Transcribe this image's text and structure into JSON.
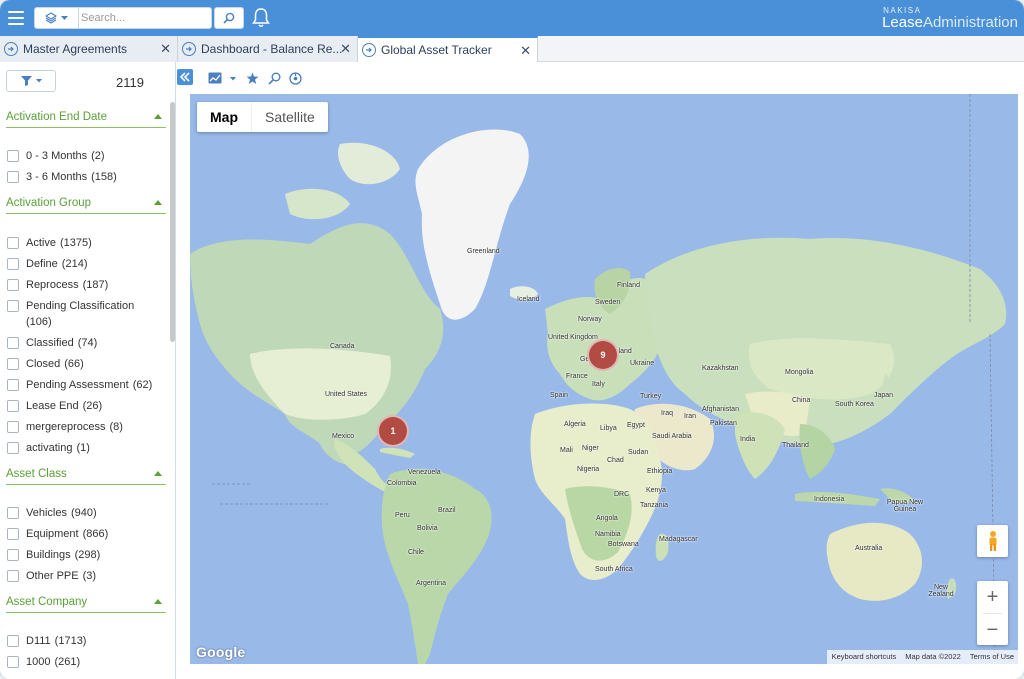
{
  "topbar": {
    "search_placeholder": "Search...",
    "brand_top": "NAKISA",
    "brand_main_1": "Lease",
    "brand_main_2": "Administration"
  },
  "tabs": [
    {
      "label": "Master Agreements"
    },
    {
      "label": "Dashboard - Balance Re..."
    },
    {
      "label": "Global Asset Tracker"
    }
  ],
  "sidebar": {
    "total": "2119",
    "sections": [
      {
        "title": "Activation End Date",
        "items": [
          {
            "label": "0 - 3 Months",
            "count": "(2)"
          },
          {
            "label": "3 - 6 Months",
            "count": "(158)"
          }
        ]
      },
      {
        "title": "Activation Group",
        "items": [
          {
            "label": "Active",
            "count": "(1375)"
          },
          {
            "label": "Define",
            "count": "(214)"
          },
          {
            "label": "Reprocess",
            "count": "(187)"
          },
          {
            "label": "Pending Classification",
            "count": "(106)"
          },
          {
            "label": "Classified",
            "count": "(74)"
          },
          {
            "label": "Closed",
            "count": "(66)"
          },
          {
            "label": "Pending Assessment",
            "count": "(62)"
          },
          {
            "label": "Lease End",
            "count": "(26)"
          },
          {
            "label": "mergereprocess",
            "count": "(8)"
          },
          {
            "label": "activating",
            "count": "(1)"
          }
        ]
      },
      {
        "title": "Asset Class",
        "items": [
          {
            "label": "Vehicles",
            "count": "(940)"
          },
          {
            "label": "Equipment",
            "count": "(866)"
          },
          {
            "label": "Buildings",
            "count": "(298)"
          },
          {
            "label": "Other PPE",
            "count": "(3)"
          }
        ]
      },
      {
        "title": "Asset Company",
        "items": [
          {
            "label": "D111",
            "count": "(1713)"
          },
          {
            "label": "1000",
            "count": "(261)"
          }
        ]
      }
    ]
  },
  "map": {
    "type_map": "Map",
    "type_satellite": "Satellite",
    "clusters": [
      {
        "label": "1"
      },
      {
        "label": "9"
      }
    ],
    "labels": {
      "greenland": "Greenland",
      "iceland": "Iceland",
      "finland": "Finland",
      "sweden": "Sweden",
      "norway": "Norway",
      "uk": "United Kingdom",
      "poland": "Poland",
      "ukraine": "Ukraine",
      "germany": "Germany",
      "france": "France",
      "italy": "Italy",
      "spain": "Spain",
      "turkey": "Turkey",
      "kazakhstan": "Kazakhstan",
      "mongolia": "Mongolia",
      "china": "China",
      "southkorea": "South Korea",
      "japan": "Japan",
      "canada": "Canada",
      "us": "United States",
      "mexico": "Mexico",
      "venezuela": "Venezuela",
      "colombia": "Colombia",
      "peru": "Peru",
      "brazil": "Brazil",
      "bolivia": "Bolivia",
      "chile": "Chile",
      "argentina": "Argentina",
      "algeria": "Algeria",
      "libya": "Libya",
      "egypt": "Egypt",
      "mali": "Mali",
      "niger": "Niger",
      "chad": "Chad",
      "sudan": "Sudan",
      "nigeria": "Nigeria",
      "ethiopia": "Ethiopia",
      "drc": "DRC",
      "kenya": "Kenya",
      "tanzania": "Tanzania",
      "angola": "Angola",
      "namibia": "Namibia",
      "botswana": "Botswana",
      "southafrica": "South Africa",
      "madagascar": "Madagascar",
      "iraq": "Iraq",
      "iran": "Iran",
      "saudi": "Saudi Arabia",
      "afghanistan": "Afghanistan",
      "pakistan": "Pakistan",
      "india": "India",
      "thailand": "Thailand",
      "indonesia": "Indonesia",
      "png": "Papua New Guinea",
      "australia": "Australia",
      "nz": "New Zealand"
    },
    "google": "Google",
    "footer": {
      "shortcuts": "Keyboard shortcuts",
      "mapdata": "Map data ©2022",
      "terms": "Terms of Use"
    }
  }
}
